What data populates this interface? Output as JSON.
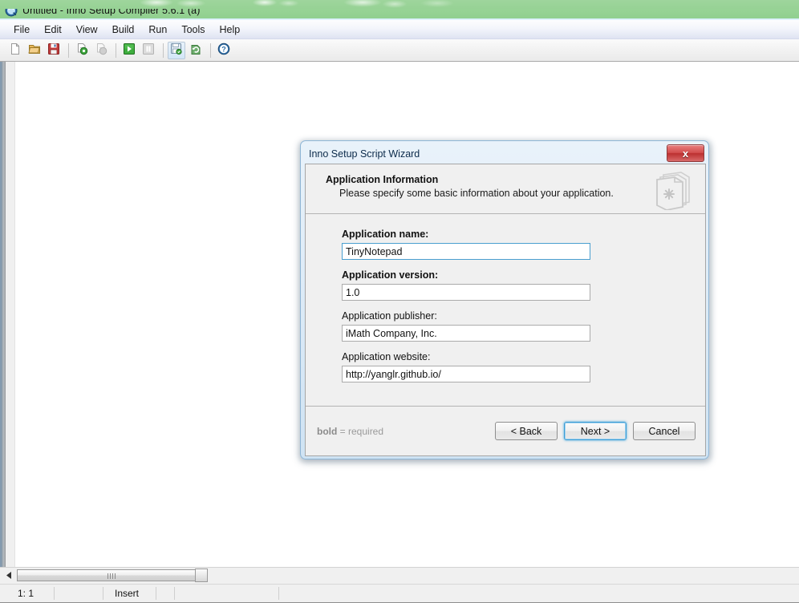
{
  "window": {
    "title": "Untitled - Inno Setup Compiler 5.6.1 (a)",
    "icon": "inno-setup-app-icon"
  },
  "menubar": {
    "items": [
      {
        "label": "File"
      },
      {
        "label": "Edit"
      },
      {
        "label": "View"
      },
      {
        "label": "Build"
      },
      {
        "label": "Run"
      },
      {
        "label": "Tools"
      },
      {
        "label": "Help"
      }
    ]
  },
  "toolbar": {
    "buttons": [
      {
        "icon": "new-file-icon",
        "name": "new-file-button"
      },
      {
        "icon": "open-folder-icon",
        "name": "open-file-button"
      },
      {
        "icon": "save-floppy-icon",
        "name": "save-file-button"
      },
      {
        "icon": "compile-icon",
        "name": "compile-button"
      },
      {
        "icon": "stop-compile-icon",
        "name": "stop-compile-button"
      },
      {
        "icon": "run-play-icon",
        "name": "run-button"
      },
      {
        "icon": "pause-icon",
        "name": "pause-button"
      },
      {
        "icon": "script-wizard-icon",
        "name": "script-wizard-button"
      },
      {
        "icon": "refresh-icon",
        "name": "refresh-button"
      },
      {
        "icon": "help-question-icon",
        "name": "help-button"
      }
    ]
  },
  "statusbar": {
    "cursor_position": "1: 1",
    "insert_mode": "Insert"
  },
  "scrollbar": {
    "left_arrow": "scroll-left-arrow-icon"
  },
  "dialog": {
    "title": "Inno Setup Script Wizard",
    "close_label": "x",
    "header": {
      "title": "Application Information",
      "subtitle": "Please specify some basic information about your application.",
      "icon": "wizard-pages-icon"
    },
    "fields": [
      {
        "label": "Application name:",
        "required": true,
        "value": "TinyNotepad",
        "placeholder": "",
        "focused": true,
        "name": "application-name-input"
      },
      {
        "label": "Application version:",
        "required": true,
        "value": "1.0",
        "placeholder": "",
        "focused": false,
        "name": "application-version-input"
      },
      {
        "label": "Application publisher:",
        "required": false,
        "value": "iMath Company, Inc.",
        "placeholder": "",
        "focused": false,
        "name": "application-publisher-input"
      },
      {
        "label": "Application website:",
        "required": false,
        "value": "http://yanglr.github.io/",
        "placeholder": "",
        "focused": false,
        "name": "application-website-input"
      }
    ],
    "footer": {
      "required_note_bold": "bold",
      "required_note_rest": " = required",
      "buttons": [
        {
          "label": "< Back",
          "name": "back-button",
          "default": false
        },
        {
          "label": "Next >",
          "name": "next-button",
          "default": true
        },
        {
          "label": "Cancel",
          "name": "cancel-button",
          "default": false
        }
      ]
    }
  },
  "colors": {
    "titlebar_green": "#9ed59c",
    "dialog_accent": "#8fb6d6",
    "close_red": "#d24d4d",
    "focus_blue": "#4a9fd0"
  }
}
